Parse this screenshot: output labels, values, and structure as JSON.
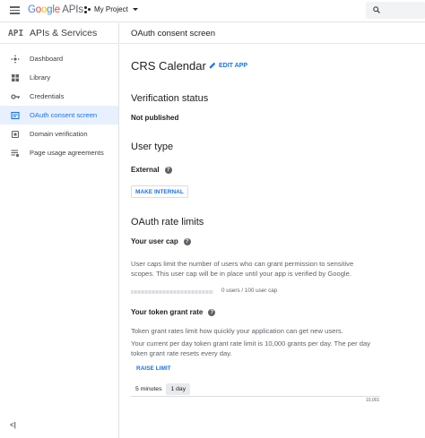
{
  "topbar": {
    "logo_google": [
      "G",
      "o",
      "o",
      "g",
      "l",
      "e"
    ],
    "logo_apis": "APIs",
    "project": "My Project"
  },
  "sidebar": {
    "api_tag": "API",
    "title": "APIs & Services",
    "items": [
      {
        "label": "Dashboard",
        "icon": "dashboard-icon"
      },
      {
        "label": "Library",
        "icon": "library-icon"
      },
      {
        "label": "Credentials",
        "icon": "key-icon"
      },
      {
        "label": "OAuth consent screen",
        "icon": "consent-icon",
        "active": true
      },
      {
        "label": "Domain verification",
        "icon": "domain-icon"
      },
      {
        "label": "Page usage agreements",
        "icon": "settings-list-icon"
      }
    ],
    "collapse": "<|"
  },
  "header": {
    "title": "OAuth consent screen"
  },
  "main": {
    "app_name": "CRS Calendar",
    "edit_app": "EDIT APP",
    "verification": {
      "heading": "Verification status",
      "status": "Not published"
    },
    "user_type": {
      "heading": "User type",
      "value": "External",
      "button": "MAKE INTERNAL"
    },
    "rate_limits": {
      "heading": "OAuth rate limits",
      "user_cap": {
        "label": "Your user cap",
        "text": "User caps limit the number of users who can grant permission to sensitive scopes. This user cap will be in place until your app is verified by Google.",
        "usage": "0 users / 100 user cap",
        "fraction": 0.0
      },
      "grant_rate": {
        "label": "Your token grant rate",
        "text1": "Token grant rates limit how quickly your application can get new users.",
        "text2": "Your current per day token grant rate limit is 10,000 grants per day. The per day token grant rate resets every day.",
        "button": "RAISE LIMIT",
        "toggle": [
          "5 minutes",
          "1 day"
        ],
        "selected": "1 day",
        "axis_max": "10,001"
      }
    }
  },
  "colors": {
    "accent": "#1a73e8",
    "active_bg": "#e8f0fe"
  }
}
